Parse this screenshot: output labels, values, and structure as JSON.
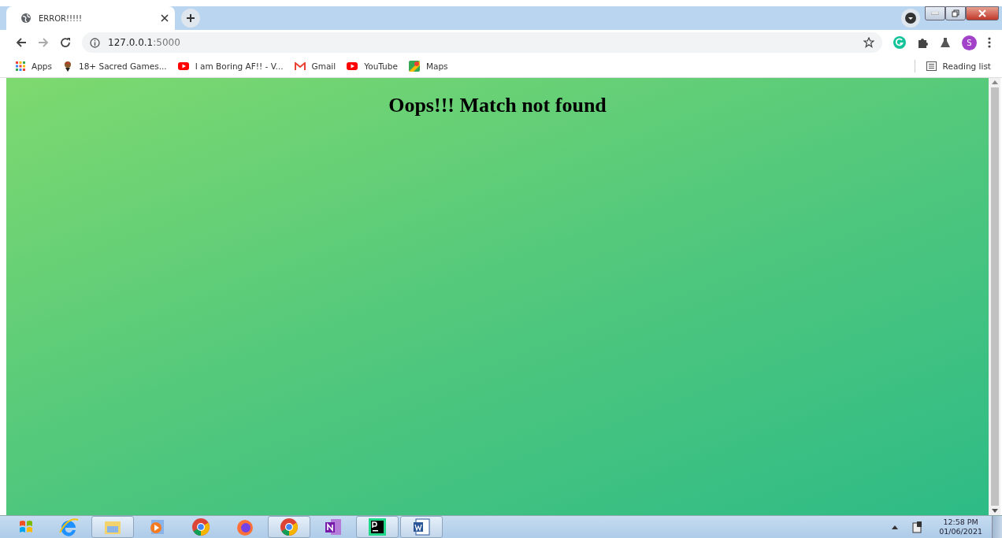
{
  "tab": {
    "title": "ERROR!!!!!",
    "selected": true
  },
  "address": {
    "host": "127.0.0.1",
    "port": ":5000"
  },
  "profile": {
    "initial": "S"
  },
  "bookmarks": [
    {
      "kind": "apps",
      "label": "Apps"
    },
    {
      "kind": "avatar",
      "label": "18+ Sacred Games..."
    },
    {
      "kind": "youtube",
      "label": "I am Boring AF!! - V..."
    },
    {
      "kind": "gmail",
      "label": "Gmail"
    },
    {
      "kind": "youtube",
      "label": "YouTube"
    },
    {
      "kind": "maps",
      "label": "Maps"
    }
  ],
  "reading_list": "Reading list",
  "page": {
    "heading": "Oops!!! Match not found"
  },
  "taskbar": [
    {
      "kind": "ie",
      "open": false
    },
    {
      "kind": "folder",
      "open": true
    },
    {
      "kind": "media",
      "open": false
    },
    {
      "kind": "chrome",
      "open": false
    },
    {
      "kind": "firefox",
      "open": false
    },
    {
      "kind": "chrome",
      "open": true
    },
    {
      "kind": "onenote",
      "open": false
    },
    {
      "kind": "pycharm",
      "open": true
    },
    {
      "kind": "word",
      "open": true
    }
  ],
  "clock": {
    "time": "12:58 PM",
    "date": "01/06/2021"
  }
}
